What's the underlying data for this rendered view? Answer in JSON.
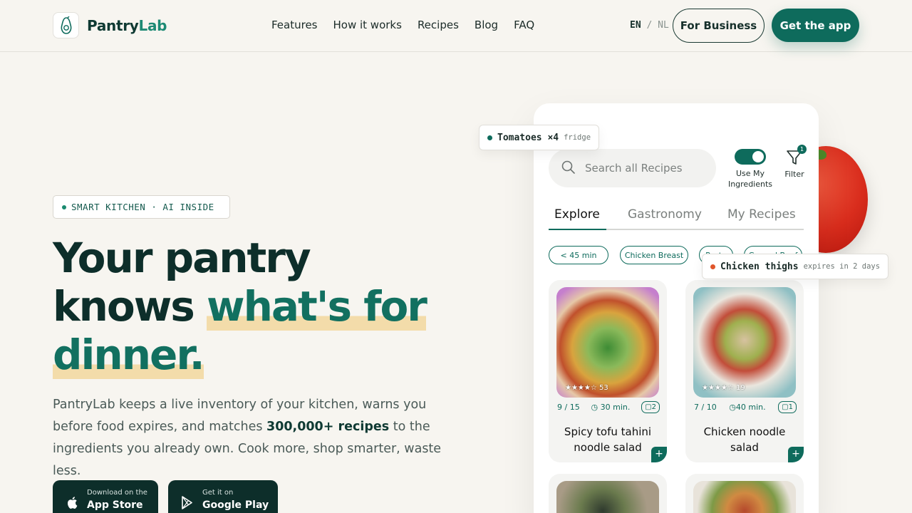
{
  "brand": {
    "name_a": "Pantry",
    "name_b": "Lab",
    "logo_icon": "avocado-icon"
  },
  "nav": [
    {
      "label": "Features"
    },
    {
      "label": "How it works"
    },
    {
      "label": "Recipes"
    },
    {
      "label": "Blog"
    },
    {
      "label": "FAQ"
    }
  ],
  "lang": {
    "active": "EN",
    "sep": "/",
    "other": "NL"
  },
  "header_buttons": {
    "business": "For Business",
    "get_app": "Get the app"
  },
  "hero": {
    "badge": "SMART KITCHEN · AI INSIDE",
    "headline_1": "Your pantry",
    "headline_2": "knows ",
    "headline_hl_1": "what's for",
    "headline_hl_2": "dinner.",
    "lead_1": "PantryLab keeps a live inventory of your kitchen, warns you before food expires, and matches ",
    "lead_bold": "300,000+ recipes",
    "lead_2": " to the ingredients you already own. Cook more, shop smarter, waste less."
  },
  "stores": {
    "apple": {
      "small": "Download on the",
      "big": "App Store",
      "icon": "apple-icon"
    },
    "google": {
      "small": "Get it on",
      "big": "Google Play",
      "icon": "play-icon"
    }
  },
  "app": {
    "search_placeholder": "Search all Recipes",
    "toggle_label": "Use My Ingredients",
    "filter_label": "Filter",
    "filter_count": "1",
    "tabs": [
      "Explore",
      "Gastronomy",
      "My Recipes"
    ],
    "chips": [
      "< 45 min",
      "Chicken Breast",
      "Pasta",
      "Ground Beef"
    ],
    "cards": [
      {
        "rating": "★★★★☆ 53",
        "match": "9 / 15",
        "time": "30 min.",
        "servings": "2",
        "title": "Spicy tofu tahini noodle salad"
      },
      {
        "rating": "★★★★☆ 19",
        "match": "7 / 10",
        "time": "40 min.",
        "servings": "1",
        "title": "Chicken noodle salad"
      }
    ]
  },
  "floats": {
    "tomatoes": {
      "item": "Tomatoes ×4",
      "note": "fridge",
      "color": "#0e6b5c"
    },
    "chicken": {
      "item": "Chicken thighs",
      "note": "expires in 2 days",
      "color": "#e0562b"
    }
  },
  "colors": {
    "brand_green": "#0e6b5c",
    "dark": "#0d2e2a",
    "highlight": "#f3dcaa",
    "background": "#f7f5f0"
  }
}
